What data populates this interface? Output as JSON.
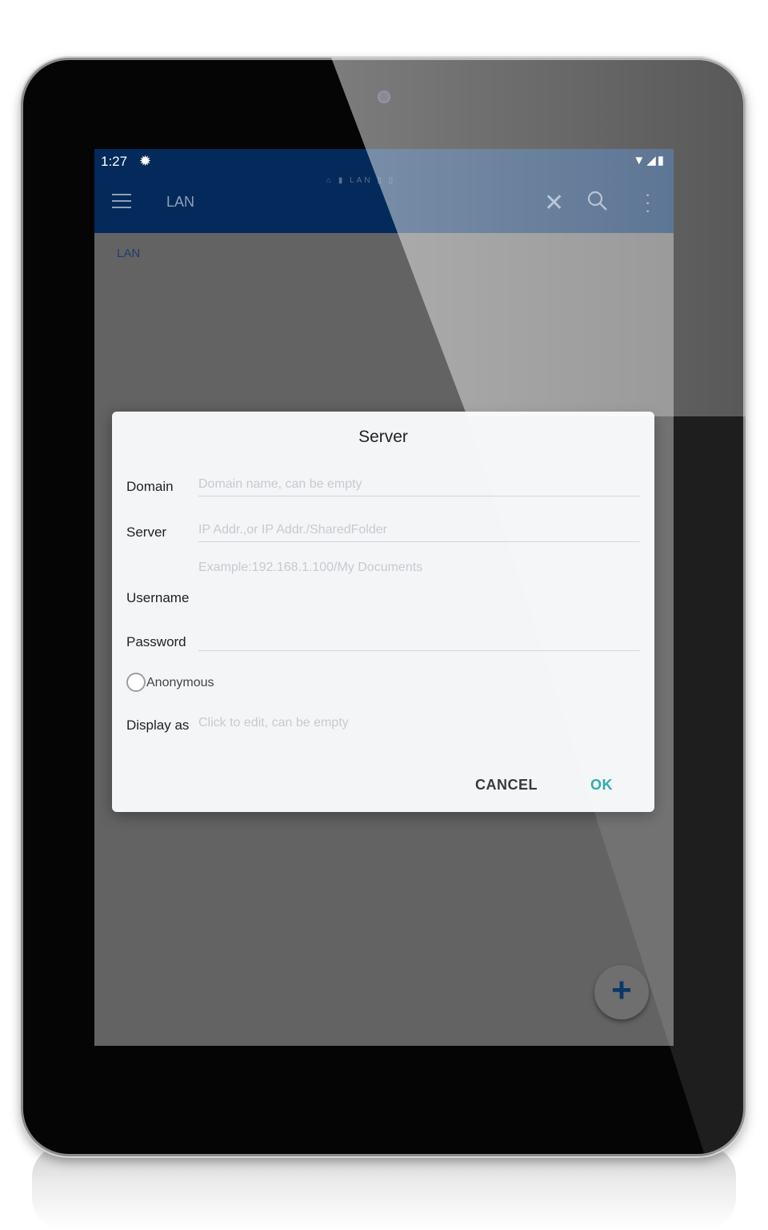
{
  "status_bar": {
    "time": "1:27",
    "settings_icon": "gear-icon",
    "right_icons": "▼◢▮"
  },
  "app_bar": {
    "crumbs": "⌂ ▮ LAN ▯ ▯",
    "title": "LAN",
    "menu_icon": "hamburger-icon",
    "close_icon": "close-icon",
    "search_icon": "search-icon",
    "overflow_icon": "overflow-icon"
  },
  "breadcrumb": "LAN",
  "dialog": {
    "title": "Server",
    "domain": {
      "label": "Domain",
      "value": "",
      "placeholder": "Domain name, can be empty"
    },
    "server": {
      "label": "Server",
      "value": "",
      "placeholder": "IP Addr.,or IP Addr./SharedFolder",
      "hint": "Example:192.168.1.100/My Documents"
    },
    "username": {
      "label": "Username",
      "value": ""
    },
    "password": {
      "label": "Password",
      "value": ""
    },
    "anonymous": {
      "label": "Anonymous",
      "checked": false
    },
    "display_as": {
      "label": "Display as",
      "value": "",
      "placeholder": "Click to edit, can be empty"
    },
    "cancel_label": "CANCEL",
    "ok_label": "OK",
    "ok_color": "#1aa3a8"
  },
  "fab": {
    "label": "+",
    "icon": "add-icon"
  },
  "colors": {
    "appbar": "#032a5a",
    "scrim": "#636363",
    "dialog_bg": "#f4f5f7"
  }
}
